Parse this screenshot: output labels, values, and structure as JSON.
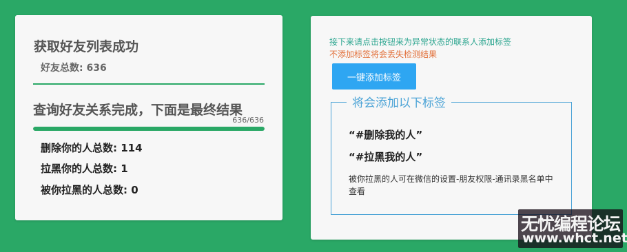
{
  "left": {
    "title": "获取好友列表成功",
    "friend_total": "好友总数: 636",
    "query_title": "查询好友关系完成，下面是最终结果",
    "progress_text": "636/636",
    "progress_fraction": 1.0,
    "stats": {
      "deleted": "删除你的人总数: 114",
      "blocked_you": "拉黑你的人总数: 1",
      "blocked_by_you": "被你拉黑的人总数: 0"
    }
  },
  "right": {
    "hint_line1": "接下来请点击按钮来为异常状态的联系人添加标签",
    "hint_line2": "不添加标签将会丢失检测结果",
    "button_label": "一键添加标签",
    "legend": "将会添加以下标签",
    "tags": [
      "“#删除我的人”",
      "“#拉黑我的人”"
    ],
    "note": "被你拉黑的人可在微信的设置-朋友权限-通讯录黑名单中查看"
  },
  "watermark": {
    "line1": "无忧编程论坛",
    "line2": "www.whct.net"
  },
  "colors": {
    "background": "#2aa866",
    "card": "#f7f7f7",
    "button": "#2ea6f2",
    "hint_teal": "#2ba58f",
    "hint_orange": "#e2703a",
    "legend_blue": "#4ba3d6"
  }
}
